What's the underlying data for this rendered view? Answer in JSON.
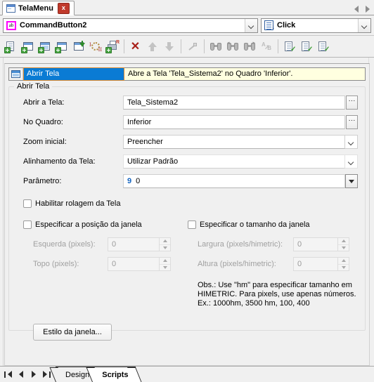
{
  "window": {
    "doc_tab": {
      "label": "TelaMenu",
      "icon": "window-icon",
      "close_label": "x"
    }
  },
  "selector": {
    "object": {
      "value": "CommandButton2",
      "icon": "ab-icon"
    },
    "event": {
      "value": "Click",
      "icon": "script-icon"
    }
  },
  "toolbar": {
    "buttons": [
      {
        "name": "new-script-icon",
        "tip": "Novo script"
      },
      {
        "name": "new-window-icon",
        "tip": "Nova janela"
      },
      {
        "name": "new-dialog-icon",
        "tip": "Novo diálogo"
      },
      {
        "name": "new-form-icon",
        "tip": "Novo formulário"
      },
      {
        "name": "insert-down-icon",
        "tip": "Inserir"
      },
      {
        "name": "loop-icon",
        "tip": "Repetição"
      },
      {
        "name": "print-report-icon",
        "tip": "Relatório"
      },
      {
        "name": "delete-icon",
        "tip": "Excluir"
      },
      {
        "name": "move-up-icon",
        "tip": "Mover para cima"
      },
      {
        "name": "move-down-icon",
        "tip": "Mover para baixo"
      },
      {
        "name": "wand-icon",
        "tip": "Assistente"
      },
      {
        "name": "find-icon",
        "tip": "Localizar"
      },
      {
        "name": "find-previous-icon",
        "tip": "Localizar anterior"
      },
      {
        "name": "find-next-icon",
        "tip": "Localizar próximo"
      },
      {
        "name": "replace-icon",
        "tip": "Substituir"
      },
      {
        "name": "check-script-icon",
        "tip": "Verificar script"
      },
      {
        "name": "check-all-icon",
        "tip": "Verificar todos"
      },
      {
        "name": "validate-icon",
        "tip": "Validar"
      }
    ]
  },
  "action": {
    "title": "Abrir Tela",
    "description": "Abre a Tela 'Tela_Sistema2' no Quadro 'Inferior'."
  },
  "group": {
    "legend": "Abrir Tela",
    "fields": [
      {
        "label": "Abrir a Tela:",
        "value": "Tela_Sistema2",
        "control": "ellipsis"
      },
      {
        "label": "No Quadro:",
        "value": "Inferior",
        "control": "ellipsis"
      },
      {
        "label": "Zoom inicial:",
        "value": "Preencher",
        "control": "dropdown"
      },
      {
        "label": "Alinhamento da Tela:",
        "value": "Utilizar Padrão",
        "control": "dropdown-flat"
      },
      {
        "label": "Parâmetro:",
        "value": "0",
        "marker": "9",
        "control": "dropdown-solid"
      }
    ],
    "checkboxes": [
      {
        "label": "Habilitar rolagem da Tela",
        "checked": false
      },
      {
        "label": "Especificar a posição da janela",
        "checked": false
      },
      {
        "label": "Especificar o tamanho da janela",
        "checked": false
      }
    ],
    "position_fields": [
      {
        "label": "Esquerda (pixels):",
        "value": "0"
      },
      {
        "label": "Topo (pixels):",
        "value": "0"
      }
    ],
    "size_fields": [
      {
        "label": "Largura (pixels/himetric):",
        "value": "0"
      },
      {
        "label": "Altura (pixels/himetric):",
        "value": "0"
      }
    ],
    "note": "Obs.: Use \"hm\" para especificar tamanho em\nHIMETRIC. Para pixels, use apenas números.\nEx.: 1000hm, 3500 hm, 100, 400",
    "style_button": "Estilo da janela..."
  },
  "bottom": {
    "nav": [
      {
        "name": "first-record-button"
      },
      {
        "name": "previous-record-button"
      },
      {
        "name": "next-record-button"
      },
      {
        "name": "last-record-button"
      }
    ],
    "tabs": [
      {
        "label": "Design",
        "active": false
      },
      {
        "label": "Scripts",
        "active": true
      }
    ]
  },
  "colors": {
    "selection_blue": "#0a7bd4",
    "selection_border": "#d88a33",
    "banner_yellow": "#ffffe0",
    "accent_magenta": "#ff00ff",
    "delete_red": "#a81f18",
    "link_blue": "#1565c0"
  }
}
